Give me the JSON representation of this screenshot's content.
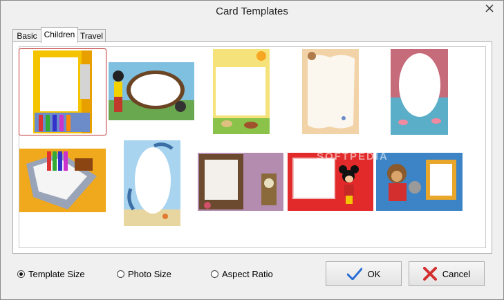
{
  "window": {
    "title": "Card Templates"
  },
  "tabs": [
    {
      "label": "Basic"
    },
    {
      "label": "Children"
    },
    {
      "label": "Travel"
    }
  ],
  "active_tab": "Children",
  "templates": [
    {
      "name": "crayons-frame",
      "selected": true
    },
    {
      "name": "cartoon-kids-frame",
      "selected": false
    },
    {
      "name": "farm-animals-frame",
      "selected": false
    },
    {
      "name": "parchment-bear-frame",
      "selected": false
    },
    {
      "name": "flamingo-oval-frame",
      "selected": false
    },
    {
      "name": "school-supplies-frame",
      "selected": false
    },
    {
      "name": "dolphin-oval-frame",
      "selected": false
    },
    {
      "name": "wood-clock-frame",
      "selected": false
    },
    {
      "name": "mickey-mouse-frame",
      "selected": false
    },
    {
      "name": "bears-blue-frame",
      "selected": false
    }
  ],
  "size_options": {
    "template_size": "Template Size",
    "photo_size": "Photo Size",
    "aspect_ratio": "Aspect Ratio",
    "selected": "template_size"
  },
  "buttons": {
    "ok": "OK",
    "cancel": "Cancel"
  },
  "watermark": "SOFTPEDIA"
}
